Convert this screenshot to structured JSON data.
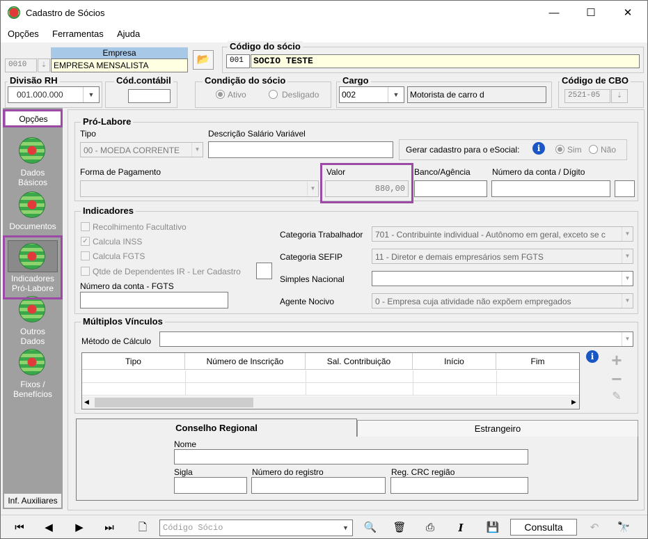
{
  "window": {
    "title": "Cadastro de Sócios"
  },
  "menu": [
    "Opções",
    "Ferramentas",
    "Ajuda"
  ],
  "empresa": {
    "label": "Empresa",
    "code": "0010",
    "name": "EMPRESA MENSALISTA"
  },
  "codigo_socio": {
    "label": "Código do sócio",
    "code": "001",
    "name": "SOCIO TESTE"
  },
  "divisao_rh": {
    "label": "Divisão RH",
    "value": "001.000.000"
  },
  "cod_contabil": {
    "label": "Cód.contábil",
    "value": ""
  },
  "condicao": {
    "label": "Condição do sócio",
    "ativo": "Ativo",
    "desligado": "Desligado"
  },
  "cargo": {
    "label": "Cargo",
    "code": "002",
    "name": "Motorista de carro d"
  },
  "cbo": {
    "label": "Código de CBO",
    "value": "2521-05"
  },
  "sidebar": {
    "title": "Opções",
    "items": [
      "Dados Básicos",
      "Documentos",
      "Indicadores Pró-Labore",
      "Outros Dados",
      "Fixos / Benefícios"
    ],
    "footer": "Inf. Auxiliares"
  },
  "prolabore": {
    "title": "Pró-Labore",
    "tipo_label": "Tipo",
    "tipo_value": "00 - MOEDA CORRENTE",
    "desc_label": "Descrição Salário Variável",
    "desc_value": "",
    "esocial_label": "Gerar cadastro para o eSocial:",
    "sim": "Sim",
    "nao": "Não",
    "forma_label": "Forma de Pagamento",
    "valor_label": "Valor",
    "valor_value": "880,00",
    "banco_label": "Banco/Agência",
    "conta_label": "Número da conta / Dígito"
  },
  "indicadores": {
    "title": "Indicadores",
    "recolhimento": "Recolhimento Facultativo",
    "inss": "Calcula INSS",
    "fgts": "Calcula FGTS",
    "dependentes": "Qtde de Dependentes IR - Ler Cadastro",
    "conta_fgts_label": "Número da conta - FGTS",
    "cat_trab_label": "Categoria Trabalhador",
    "cat_trab_value": "701 - Contribuinte individual - Autônomo em geral, exceto se c",
    "cat_sefip_label": "Categoria SEFIP",
    "cat_sefip_value": "11 - Diretor e demais empresários sem FGTS",
    "simples_label": "Simples Nacional",
    "simples_value": "",
    "agente_label": "Agente Nocivo",
    "agente_value": "0 - Empresa cuja atividade não expõem empregados"
  },
  "multiplos": {
    "title": "Múltiplos Vínculos",
    "metodo_label": "Método de Cálculo",
    "columns": [
      "Tipo",
      "Número de Inscrição",
      "Sal. Contribuição",
      "Início",
      "Fim"
    ]
  },
  "tabs": {
    "conselho": "Conselho Regional",
    "estrangeiro": "Estrangeiro"
  },
  "conselho": {
    "nome_label": "Nome",
    "sigla_label": "Sigla",
    "registro_label": "Número do registro",
    "crc_label": "Reg. CRC região"
  },
  "toolbar": {
    "search_placeholder": "Código Sócio",
    "consulta": "Consulta"
  }
}
